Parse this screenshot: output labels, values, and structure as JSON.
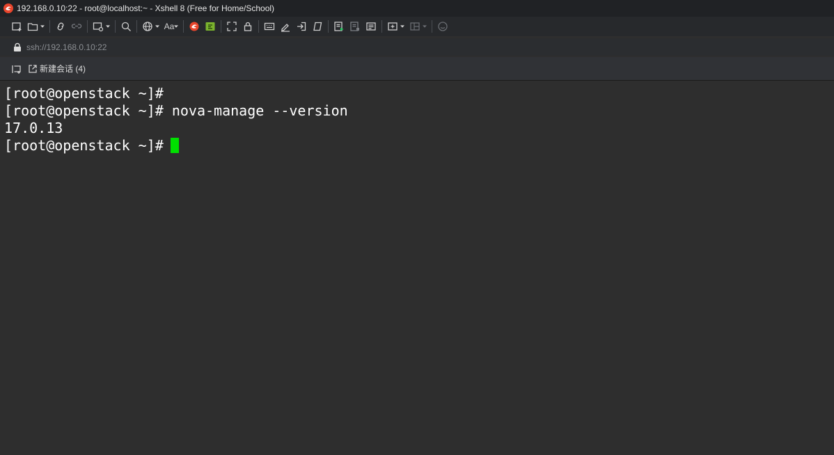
{
  "window": {
    "title": "192.168.0.10:22 - root@localhost:~ - Xshell 8 (Free for Home/School)",
    "app_icon": "xshell-logo-icon",
    "accent_color": "#e8452c"
  },
  "toolbar": {
    "buttons": [
      {
        "icon": "new-session-icon"
      },
      {
        "icon": "open-folder-icon"
      },
      {
        "icon": "reconnect-icon"
      },
      {
        "icon": "disconnect-icon"
      },
      {
        "icon": "new-tab-icon"
      },
      {
        "icon": "find-icon"
      },
      {
        "icon": "globe-icon"
      },
      {
        "icon": "font-icon",
        "label": "Aa"
      },
      {
        "icon": "xshell-icon"
      },
      {
        "icon": "xftp-icon"
      },
      {
        "icon": "fullscreen-icon"
      },
      {
        "icon": "lock-icon"
      },
      {
        "icon": "keyboard-icon"
      },
      {
        "icon": "highlight-icon"
      },
      {
        "icon": "transfer-icon"
      },
      {
        "icon": "script-icon"
      },
      {
        "icon": "start-log-icon"
      },
      {
        "icon": "stop-log-icon"
      },
      {
        "icon": "compose-icon"
      },
      {
        "icon": "add-icon"
      },
      {
        "icon": "layout-icon"
      },
      {
        "icon": "chat-icon"
      }
    ]
  },
  "address": {
    "url": "ssh://192.168.0.10:22"
  },
  "tabs": {
    "new_session_label": "新建会话 (4)"
  },
  "terminal": {
    "lines": [
      "[root@openstack ~]#",
      "[root@openstack ~]# nova-manage --version",
      "17.0.13",
      "[root@openstack ~]# "
    ],
    "cursor_color": "#00e000",
    "background": "#2e2e2e",
    "text_color": "#ffffff"
  }
}
